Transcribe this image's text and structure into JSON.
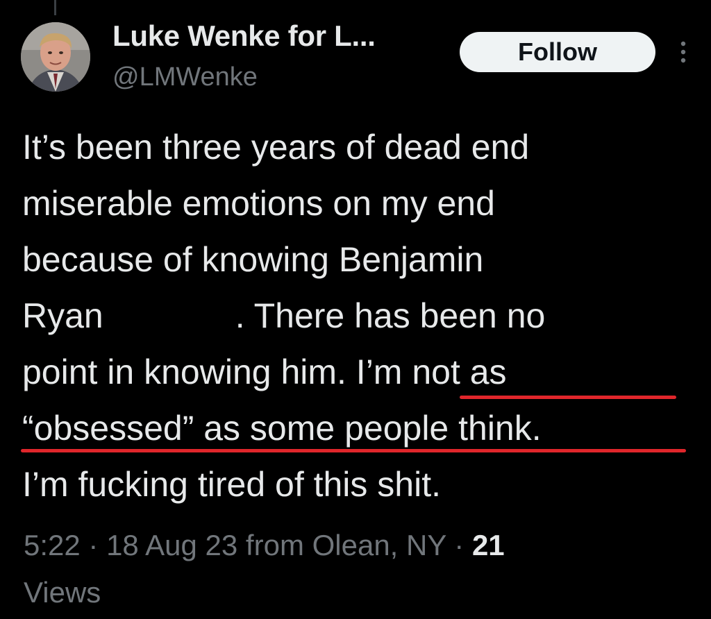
{
  "author": {
    "display_name": "Luke Wenke for L...",
    "handle": "@LMWenke"
  },
  "follow_label": "Follow",
  "tweet": {
    "lines": [
      "It’s been three years of dead end",
      "miserable emotions on my end",
      "because of knowing Benjamin",
      "Ryan",
      ".  There has been no",
      "point in knowing him.  I’m not as",
      "“obsessed” as some people think.",
      "I’m fucking tired of this shit."
    ]
  },
  "meta": {
    "time": "5:22",
    "sep1": " · ",
    "date": "18 Aug 23",
    "location_prefix": " from ",
    "location": "Olean, NY",
    "sep2": " · ",
    "views_count": "21",
    "views_label": "Views"
  },
  "colors": {
    "background": "#000000",
    "text_primary": "#e7e9ea",
    "text_secondary": "#71767b",
    "follow_bg": "#eff3f4",
    "annotation_underline": "#e0262b"
  },
  "icons": {
    "more": "more-vertical-icon"
  }
}
